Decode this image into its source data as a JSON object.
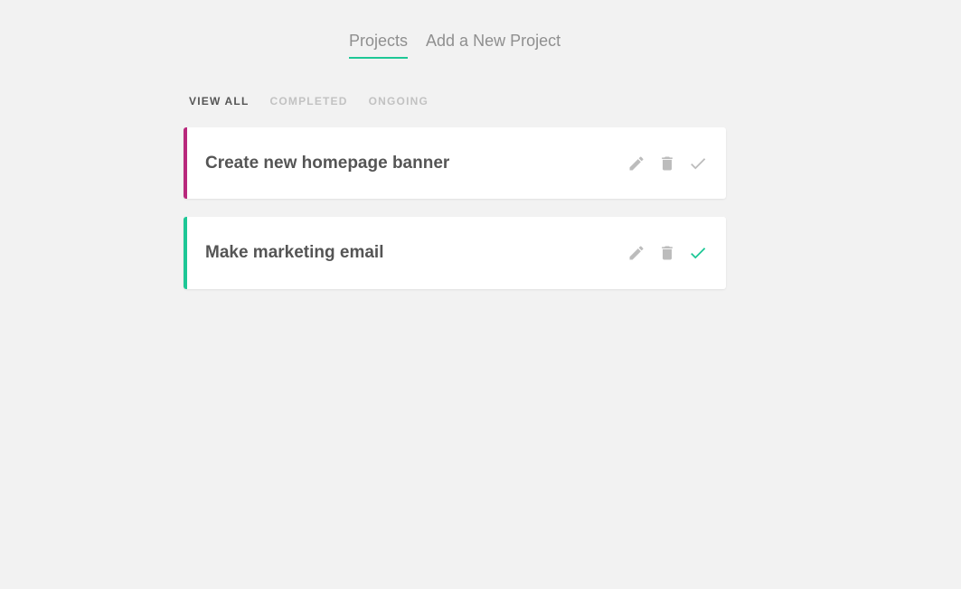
{
  "nav": {
    "items": [
      {
        "label": "Projects",
        "active": true
      },
      {
        "label": "Add a New Project",
        "active": false
      }
    ]
  },
  "filters": {
    "items": [
      {
        "label": "VIEW ALL",
        "active": true
      },
      {
        "label": "COMPLETED",
        "active": false
      },
      {
        "label": "ONGOING",
        "active": false
      }
    ]
  },
  "projects": [
    {
      "title": "Create new homepage banner",
      "complete": false,
      "status_color": "#b8287c"
    },
    {
      "title": "Make marketing email",
      "complete": true,
      "status_color": "#1ec796"
    }
  ],
  "icons": {
    "edit": "pencil-icon",
    "delete": "trash-icon",
    "complete": "checkmark-icon"
  },
  "colors": {
    "accent": "#1ec796",
    "ongoing": "#b8287c",
    "icon_gray": "#bcbcbc",
    "background": "#f2f2f2"
  }
}
